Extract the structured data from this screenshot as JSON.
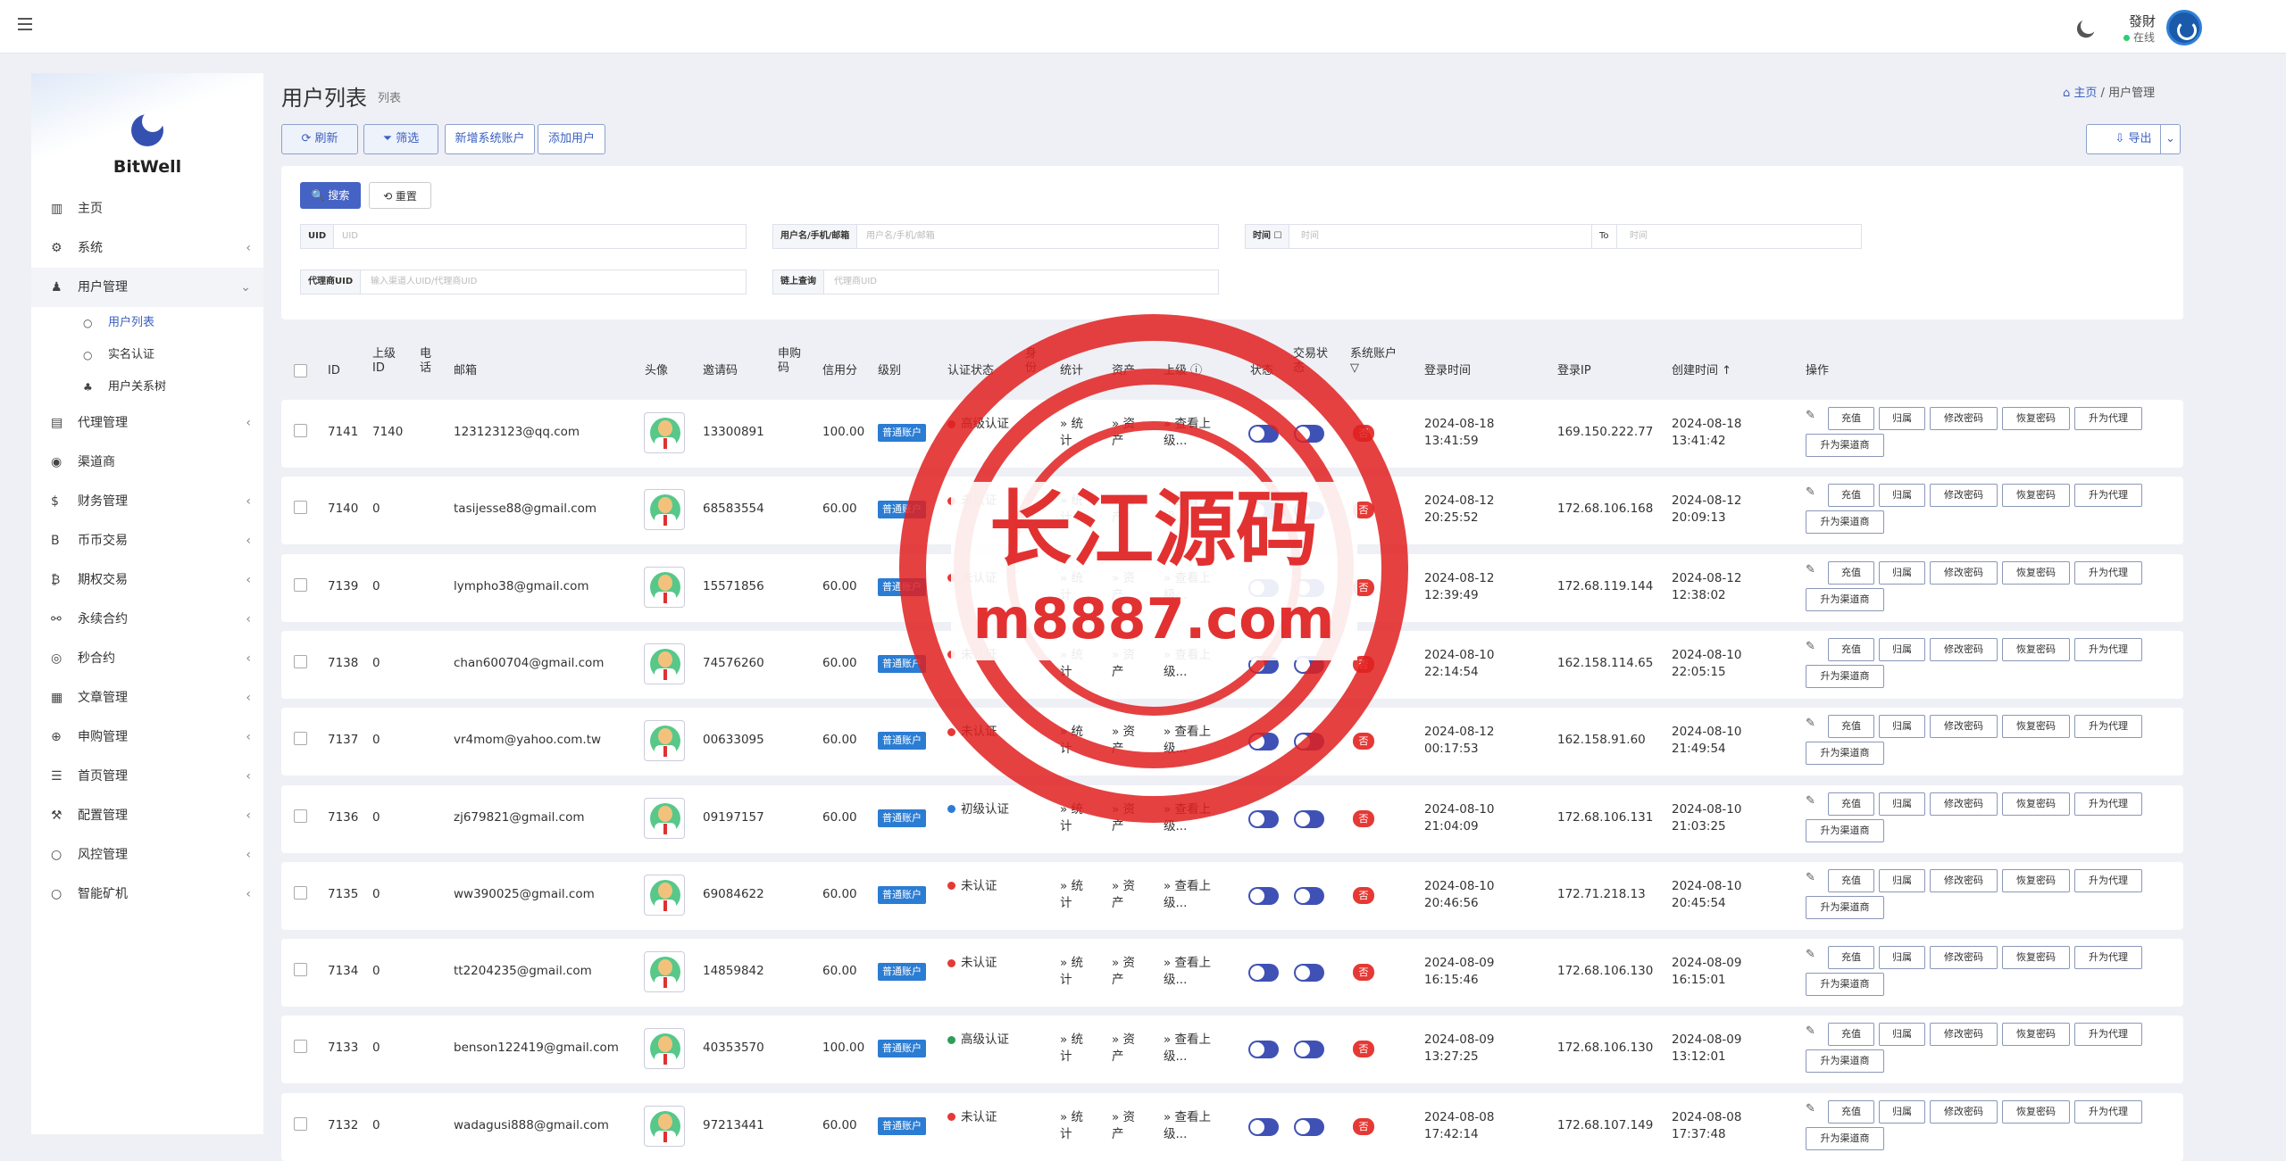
{
  "topbar": {
    "user_name": "發財",
    "user_status": "在线"
  },
  "sidebar": {
    "brand": "BitWell",
    "items": [
      {
        "label": "主页",
        "icon": "bar-chart-icon",
        "glyph": "▥",
        "chev": ""
      },
      {
        "label": "系统",
        "icon": "gear-icon",
        "glyph": "⚙",
        "chev": "‹"
      },
      {
        "label": "用户管理",
        "icon": "user-icon",
        "glyph": "♟",
        "chev": "⌄"
      },
      {
        "label": "代理管理",
        "icon": "id-card-icon",
        "glyph": "▤",
        "chev": "‹"
      },
      {
        "label": "渠道商",
        "icon": "user-circle-icon",
        "glyph": "◉",
        "chev": ""
      },
      {
        "label": "财务管理",
        "icon": "dollar-icon",
        "glyph": "$",
        "chev": "‹"
      },
      {
        "label": "币币交易",
        "icon": "bitcoin-icon",
        "glyph": "B",
        "chev": "‹"
      },
      {
        "label": "期权交易",
        "icon": "bitcoin-icon",
        "glyph": "₿",
        "chev": "‹"
      },
      {
        "label": "永续合约",
        "icon": "link-icon",
        "glyph": "⚯",
        "chev": "‹"
      },
      {
        "label": "秒合约",
        "icon": "dot-circle-icon",
        "glyph": "◎",
        "chev": "‹"
      },
      {
        "label": "文章管理",
        "icon": "newspaper-icon",
        "glyph": "▦",
        "chev": "‹"
      },
      {
        "label": "申购管理",
        "icon": "globe-icon",
        "glyph": "⊕",
        "chev": "‹"
      },
      {
        "label": "首页管理",
        "icon": "list-icon",
        "glyph": "☰",
        "chev": "‹"
      },
      {
        "label": "配置管理",
        "icon": "wrench-icon",
        "glyph": "⚒",
        "chev": "‹"
      },
      {
        "label": "风控管理",
        "icon": "circle-icon",
        "glyph": "○",
        "chev": "‹"
      },
      {
        "label": "智能矿机",
        "icon": "circle-icon",
        "glyph": "○",
        "chev": "‹"
      }
    ],
    "subitems": [
      {
        "label": "用户列表",
        "glyph": "○"
      },
      {
        "label": "实名认证",
        "glyph": "○"
      },
      {
        "label": "用户关系树",
        "glyph": "♣"
      }
    ]
  },
  "page": {
    "title": "用户列表",
    "subtitle": "列表",
    "crumb_home": "主页",
    "crumb_current": "用户管理"
  },
  "toolbar": {
    "refresh": "⟳ 刷新",
    "filter": "⏷ 筛选",
    "add_system": "新增系统账户",
    "add_user": "添加用户",
    "export": "⇩ 导出"
  },
  "search": {
    "search_btn": "🔍 搜索",
    "reset_btn": "⟲ 重置",
    "uid_label": "UID",
    "uid_ph": "UID",
    "name_label": "用户名/手机/邮箱",
    "name_ph": "用户名/手机/邮箱",
    "time_label": "时间 ☐",
    "time_ph": "时间",
    "to_label": "To",
    "to_ph": "时间",
    "agent_label": "代理商UID",
    "agent_ph": "输入渠道人UID/代理商UID",
    "chain_label": "链上查询",
    "chain_ph": "代理商UID"
  },
  "table": {
    "headers": {
      "id": "ID",
      "parent": "上级ID",
      "phone": "电话",
      "email": "邮箱",
      "avatar": "头像",
      "invite": "邀请码",
      "purchase": "申购码",
      "credit": "信用分",
      "level": "级别",
      "auth": "认证状态",
      "identity": "身份",
      "stats": "统计",
      "assets": "资产",
      "parent_view": "上级 ⓘ",
      "status": "状态",
      "trade": "交易状态",
      "system": "系统账户 ▽",
      "login_time": "登录时间",
      "login_ip": "登录IP",
      "created": "创建时间 ↑",
      "ops": "操作"
    },
    "actions": {
      "recharge": "充值",
      "attribution": "归属",
      "change_pwd": "修改密码",
      "reset_pwd": "恢复密码",
      "upgrade": "升为代理",
      "channel": "升为渠道商"
    },
    "link_stats": "» 统计",
    "link_assets": "» 资产",
    "link_parent": "» 查看上级...",
    "rows": [
      {
        "id": "7141",
        "parent": "7140",
        "email": "123123123@qq.com",
        "invite": "13300891",
        "credit": "100.00",
        "level": "普通账户",
        "auth": "高级认证",
        "auth_color": "#e53935",
        "sys": "否",
        "login_time": "2024-08-18 13:41:59",
        "ip": "169.150.222.77",
        "created": "2024-08-18 13:41:42"
      },
      {
        "id": "7140",
        "parent": "0",
        "email": "tasijesse88@gmail.com",
        "invite": "68583554",
        "credit": "60.00",
        "level": "普通账户",
        "auth": "未认证",
        "auth_color": "#e53935",
        "sys": "否",
        "login_time": "2024-08-12 20:25:52",
        "ip": "172.68.106.168",
        "created": "2024-08-12 20:09:13"
      },
      {
        "id": "7139",
        "parent": "0",
        "email": "lympho38@gmail.com",
        "invite": "15571856",
        "credit": "60.00",
        "level": "普通账户",
        "auth": "未认证",
        "auth_color": "#e53935",
        "sys": "否",
        "login_time": "2024-08-12 12:39:49",
        "ip": "172.68.119.144",
        "created": "2024-08-12 12:38:02"
      },
      {
        "id": "7138",
        "parent": "0",
        "email": "chan600704@gmail.com",
        "invite": "74576260",
        "credit": "60.00",
        "level": "普通账户",
        "auth": "未认证",
        "auth_color": "#e53935",
        "sys": "否",
        "login_time": "2024-08-10 22:14:54",
        "ip": "162.158.114.65",
        "created": "2024-08-10 22:05:15"
      },
      {
        "id": "7137",
        "parent": "0",
        "email": "vr4mom@yahoo.com.tw",
        "invite": "00633095",
        "credit": "60.00",
        "level": "普通账户",
        "auth": "未认证",
        "auth_color": "#e53935",
        "sys": "否",
        "login_time": "2024-08-12 00:17:53",
        "ip": "162.158.91.60",
        "created": "2024-08-10 21:49:54"
      },
      {
        "id": "7136",
        "parent": "0",
        "email": "zj679821@gmail.com",
        "invite": "09197157",
        "credit": "60.00",
        "level": "普通账户",
        "auth": "初级认证",
        "auth_color": "#2b7cd3",
        "sys": "否",
        "login_time": "2024-08-10 21:04:09",
        "ip": "172.68.106.131",
        "created": "2024-08-10 21:03:25"
      },
      {
        "id": "7135",
        "parent": "0",
        "email": "ww390025@gmail.com",
        "invite": "69084622",
        "credit": "60.00",
        "level": "普通账户",
        "auth": "未认证",
        "auth_color": "#e53935",
        "sys": "否",
        "login_time": "2024-08-10 20:46:56",
        "ip": "172.71.218.13",
        "created": "2024-08-10 20:45:54"
      },
      {
        "id": "7134",
        "parent": "0",
        "email": "tt2204235@gmail.com",
        "invite": "14859842",
        "credit": "60.00",
        "level": "普通账户",
        "auth": "未认证",
        "auth_color": "#e53935",
        "sys": "否",
        "login_time": "2024-08-09 16:15:46",
        "ip": "172.68.106.130",
        "created": "2024-08-09 16:15:01"
      },
      {
        "id": "7133",
        "parent": "0",
        "email": "benson122419@gmail.com",
        "invite": "40353570",
        "credit": "100.00",
        "level": "普通账户",
        "auth": "高级认证",
        "auth_color": "#2e9d5a",
        "sys": "否",
        "login_time": "2024-08-09 13:27:25",
        "ip": "172.68.106.130",
        "created": "2024-08-09 13:12:01"
      },
      {
        "id": "7132",
        "parent": "0",
        "email": "wadagusi888@gmail.com",
        "invite": "97213441",
        "credit": "60.00",
        "level": "普通账户",
        "auth": "未认证",
        "auth_color": "#e53935",
        "sys": "否",
        "login_time": "2024-08-08 17:42:14",
        "ip": "172.68.107.149",
        "created": "2024-08-08 17:37:48"
      }
    ]
  },
  "watermark": {
    "line1": "长江源码",
    "line2": "m8887.com",
    "color": "#e02020"
  }
}
